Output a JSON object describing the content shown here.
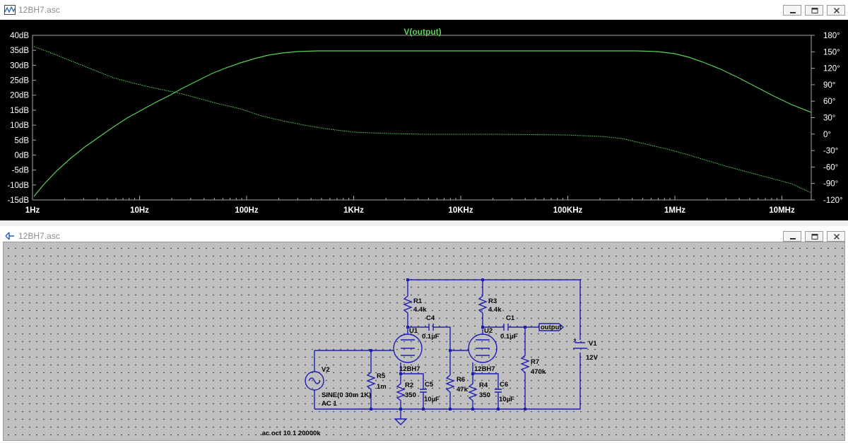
{
  "top_window": {
    "title": "12BH7.asc",
    "trace_label": "V(output)",
    "left_axis": [
      "40dB",
      "35dB",
      "30dB",
      "25dB",
      "20dB",
      "15dB",
      "10dB",
      "5dB",
      "0dB",
      "-5dB",
      "-10dB",
      "-15dB"
    ],
    "right_axis": [
      "180°",
      "150°",
      "120°",
      "90°",
      "60°",
      "30°",
      "0°",
      "-30°",
      "-60°",
      "-90°",
      "-120°"
    ],
    "x_axis": [
      "1Hz",
      "10Hz",
      "100Hz",
      "1KHz",
      "10KHz",
      "100KHz",
      "1MHz",
      "10MHz"
    ]
  },
  "bottom_window": {
    "title": "12BH7.asc",
    "components": {
      "r1": {
        "name": "R1",
        "value": "4.4k"
      },
      "r3": {
        "name": "R3",
        "value": "4.4k"
      },
      "c4": {
        "name": "C4",
        "value": "0.1µF"
      },
      "c1": {
        "name": "C1",
        "value": "0.1µF"
      },
      "u1": {
        "name": "U1",
        "model": "12BH7"
      },
      "u2": {
        "name": "U2",
        "model": "12BH7"
      },
      "r5": {
        "name": "R5",
        "value": "1m"
      },
      "r2": {
        "name": "R2",
        "value": "350"
      },
      "c5": {
        "name": "C5",
        "value": "10µF"
      },
      "r6": {
        "name": "R6",
        "value": "47k"
      },
      "r4": {
        "name": "R4",
        "value": "350"
      },
      "c6": {
        "name": "C6",
        "value": "10µF"
      },
      "r7": {
        "name": "R7",
        "value": "470k"
      },
      "v1": {
        "name": "V1",
        "value": "12V"
      },
      "v2": {
        "name": "V2",
        "value": "SINE(0 30m 1K)",
        "ac": "AC 1"
      }
    },
    "output_label": "output",
    "directive": ".ac oct 10 1 20000k"
  },
  "colors": {
    "trace": "#58d058",
    "plot_bg": "#000000",
    "wire": "#1e1eb4",
    "schematic_bg": "#c0c0c0",
    "axis_text": "#ffffff"
  },
  "icons": {
    "top_window_icon": "waveform-icon",
    "bottom_window_icon": "schematic-icon"
  }
}
